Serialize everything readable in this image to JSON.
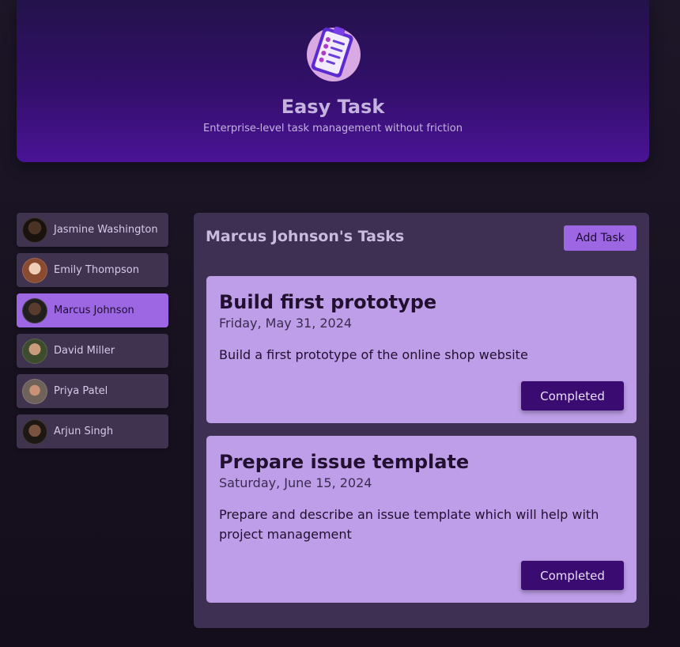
{
  "header": {
    "title": "Easy Task",
    "subtitle": "Enterprise-level task management without friction",
    "logo_icon": "clipboard-checklist-icon"
  },
  "users": [
    {
      "name": "Jasmine Washington",
      "avatar_color": "#2a1d16",
      "active": false
    },
    {
      "name": "Emily Thompson",
      "avatar_color": "#b07a5a",
      "active": false
    },
    {
      "name": "Marcus Johnson",
      "avatar_color": "#3a2a22",
      "active": true
    },
    {
      "name": "David Miller",
      "avatar_color": "#4a5f3a",
      "active": false
    },
    {
      "name": "Priya Patel",
      "avatar_color": "#8a6a55",
      "active": false
    },
    {
      "name": "Arjun Singh",
      "avatar_color": "#3a2a20",
      "active": false
    }
  ],
  "tasks_panel": {
    "title": "Marcus Johnson's Tasks",
    "add_button_label": "Add Task"
  },
  "tasks": [
    {
      "title": "Build first prototype",
      "date": "Friday, May 31, 2024",
      "description": "Build a first prototype of the online shop website",
      "status_label": "Completed"
    },
    {
      "title": "Prepare issue template",
      "date": "Saturday, June 15, 2024",
      "description": "Prepare and describe an issue template which will help with project management",
      "status_label": "Completed"
    }
  ],
  "colors": {
    "accent": "#9d67e4",
    "card": "#be9ee8",
    "button_dark": "#3a0c72"
  }
}
